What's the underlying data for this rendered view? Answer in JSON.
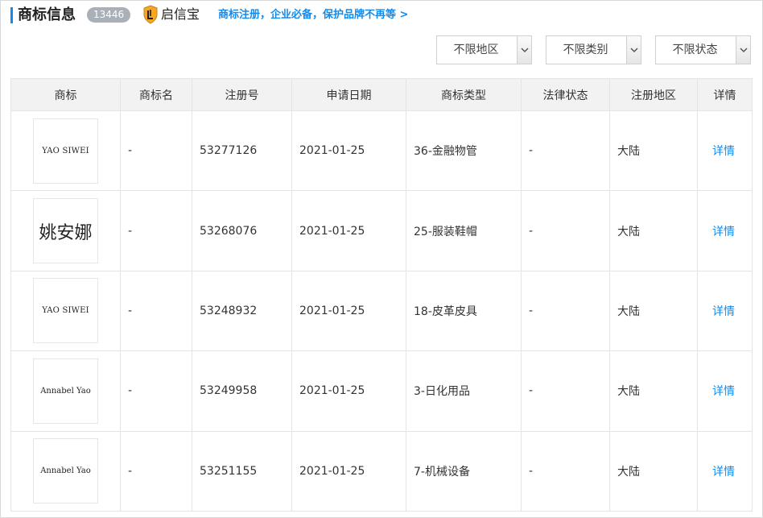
{
  "header": {
    "title": "商标信息",
    "count": "13446",
    "brand_name": "启信宝",
    "promo_link": "商标注册，企业必备，保护品牌不再等 >"
  },
  "filters": [
    {
      "label": "不限地区"
    },
    {
      "label": "不限类别"
    },
    {
      "label": "不限状态"
    }
  ],
  "table": {
    "columns": [
      "商标",
      "商标名",
      "注册号",
      "申请日期",
      "商标类型",
      "法律状态",
      "注册地区",
      "详情"
    ],
    "rows": [
      {
        "logo_text": "YAO SIWEI",
        "name": "-",
        "reg_no": "53277126",
        "date": "2021-01-25",
        "type": "36-金融物管",
        "status": "-",
        "region": "大陆",
        "detail": "详情"
      },
      {
        "logo_text": "姚安娜",
        "name": "-",
        "reg_no": "53268076",
        "date": "2021-01-25",
        "type": "25-服装鞋帽",
        "status": "-",
        "region": "大陆",
        "detail": "详情"
      },
      {
        "logo_text": "YAO SIWEI",
        "name": "-",
        "reg_no": "53248932",
        "date": "2021-01-25",
        "type": "18-皮革皮具",
        "status": "-",
        "region": "大陆",
        "detail": "详情"
      },
      {
        "logo_text": "Annabel Yao",
        "name": "-",
        "reg_no": "53249958",
        "date": "2021-01-25",
        "type": "3-日化用品",
        "status": "-",
        "region": "大陆",
        "detail": "详情"
      },
      {
        "logo_text": "Annabel Yao",
        "name": "-",
        "reg_no": "53251155",
        "date": "2021-01-25",
        "type": "7-机械设备",
        "status": "-",
        "region": "大陆",
        "detail": "详情"
      }
    ]
  },
  "colors": {
    "accent": "#128bed",
    "badge": "#a9b0b8",
    "brand_shield": "#f5a623"
  },
  "icons": [
    "qixinbao-shield-icon",
    "chevron-down-icon"
  ]
}
